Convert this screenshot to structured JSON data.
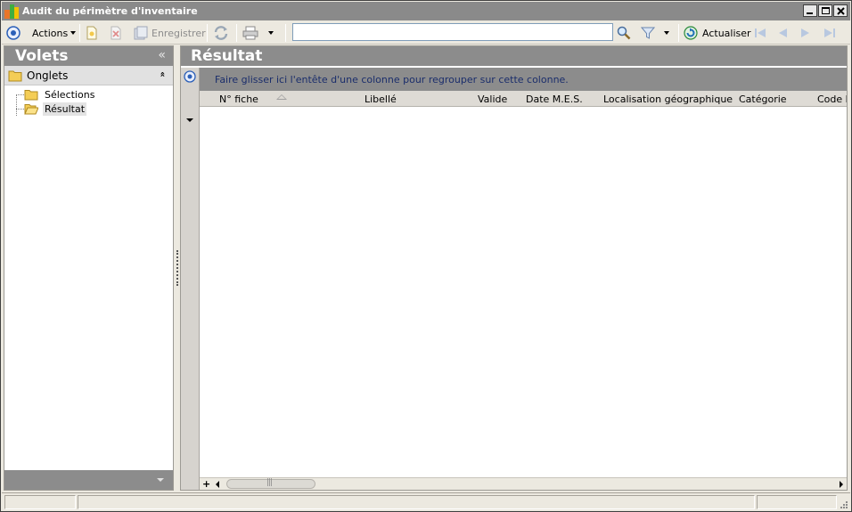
{
  "window": {
    "title": "Audit du périmètre d'inventaire"
  },
  "toolbar": {
    "actions_label": "Actions",
    "save_label": "Enregistrer",
    "search_value": "",
    "refresh_label": "Actualiser"
  },
  "left_pane": {
    "title": "Volets",
    "collapse_glyph": "«",
    "group_label": "Onglets",
    "group_toggle_glyph": "«",
    "items": [
      {
        "label": "Sélections",
        "selected": false
      },
      {
        "label": "Résultat",
        "selected": true
      }
    ]
  },
  "right_pane": {
    "title": "Résultat",
    "group_hint": "Faire glisser ici l'entête d'une colonne pour regrouper sur cette colonne.",
    "columns": [
      "N° fiche",
      "Libellé",
      "Valide",
      "Date M.E.S.",
      "Localisation géographique",
      "Catégorie",
      "Code b"
    ],
    "scroll_add_glyph": "+"
  },
  "colors": {
    "header_gray": "#8c8c8c",
    "hint_text": "#1a2d6b",
    "logo_orange": "#f07a1a",
    "logo_green": "#33aa33"
  }
}
